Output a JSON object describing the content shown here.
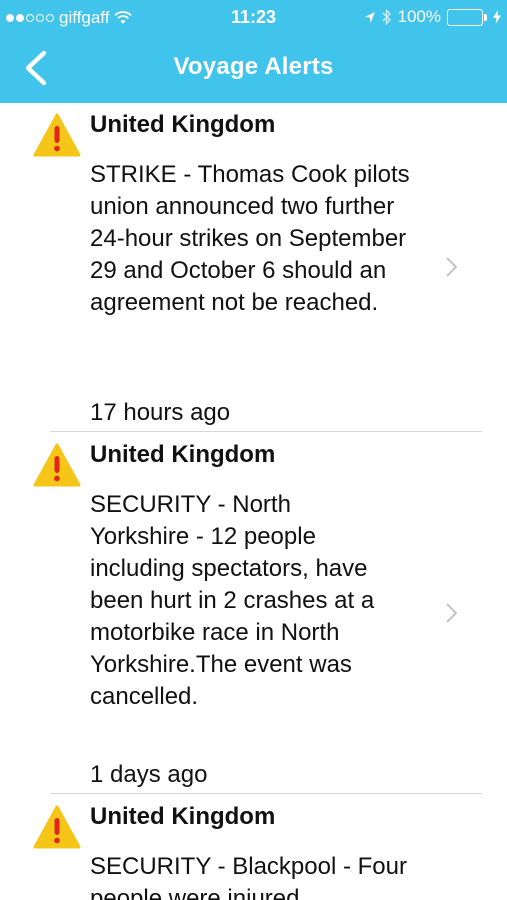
{
  "status_bar": {
    "carrier": "giffgaff",
    "time": "11:23",
    "battery": "100%"
  },
  "nav": {
    "title": "Voyage Alerts"
  },
  "alerts": [
    {
      "country": "United Kingdom",
      "description": "STRIKE - Thomas Cook pilots union announced two further 24-hour strikes on September 29 and October 6 should an agreement not be reached.",
      "time": "17 hours ago"
    },
    {
      "country": "United Kingdom",
      "description": "SECURITY - North Yorkshire - 12 people including spectators, have been hurt in 2 crashes at a motorbike race in North Yorkshire.The event was cancelled.",
      "time": "1 days ago"
    },
    {
      "country": "United Kingdom",
      "description": "SECURITY - Blackpool - Four people were injured",
      "time": ""
    }
  ],
  "colors": {
    "header": "#40c4ec",
    "warning": "#f5c518",
    "warning_mark": "#e0261b",
    "battery": "#7ce04a"
  }
}
